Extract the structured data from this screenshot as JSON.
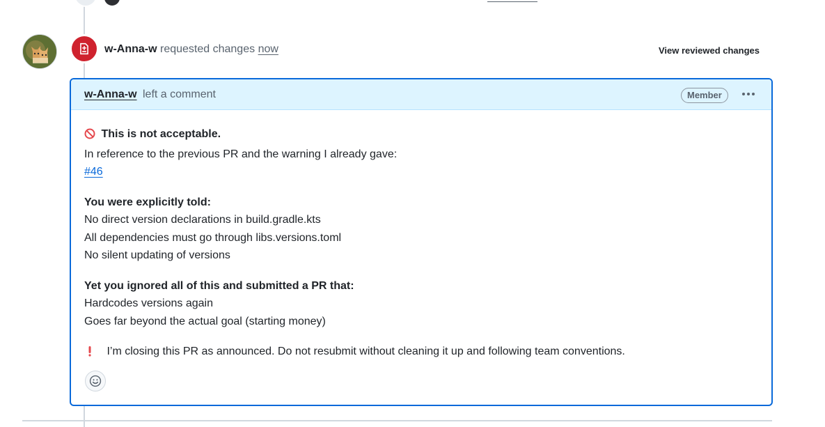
{
  "review": {
    "author": "w-Anna-w",
    "action_text": "requested changes",
    "time": "now",
    "view_changes_label": "View reviewed changes",
    "status_color": "#cf222e",
    "avatar_icon": "cat-avatar",
    "badge_icon": "file-diff-icon"
  },
  "comment": {
    "author": "w-Anna-w",
    "action_text": "left a comment",
    "role_badge": "Member",
    "more_options_icon": "kebab-horizontal-icon",
    "heading_icon": "no-entry-icon",
    "heading": "This is not acceptable.",
    "intro": "In reference to the previous PR and the warning I already gave:",
    "issue_link": "#46",
    "told_heading": "You were explicitly told:",
    "told_items": [
      "No direct version declarations in build.gradle.kts",
      "All dependencies must go through libs.versions.toml",
      "No silent updating of versions"
    ],
    "ignored_heading": "Yet you ignored all of this and submitted a PR that:",
    "ignored_items": [
      "Hardcodes versions again",
      "Goes far beyond the actual goal (starting money)"
    ],
    "closing_icon": "exclamation-icon",
    "closing": "I’m closing this PR as announced. Do not resubmit without cleaning it up and following team conventions.",
    "reaction_icon": "smiley-icon",
    "accent_color": "#0969da",
    "header_bg": "#ddf4ff"
  }
}
